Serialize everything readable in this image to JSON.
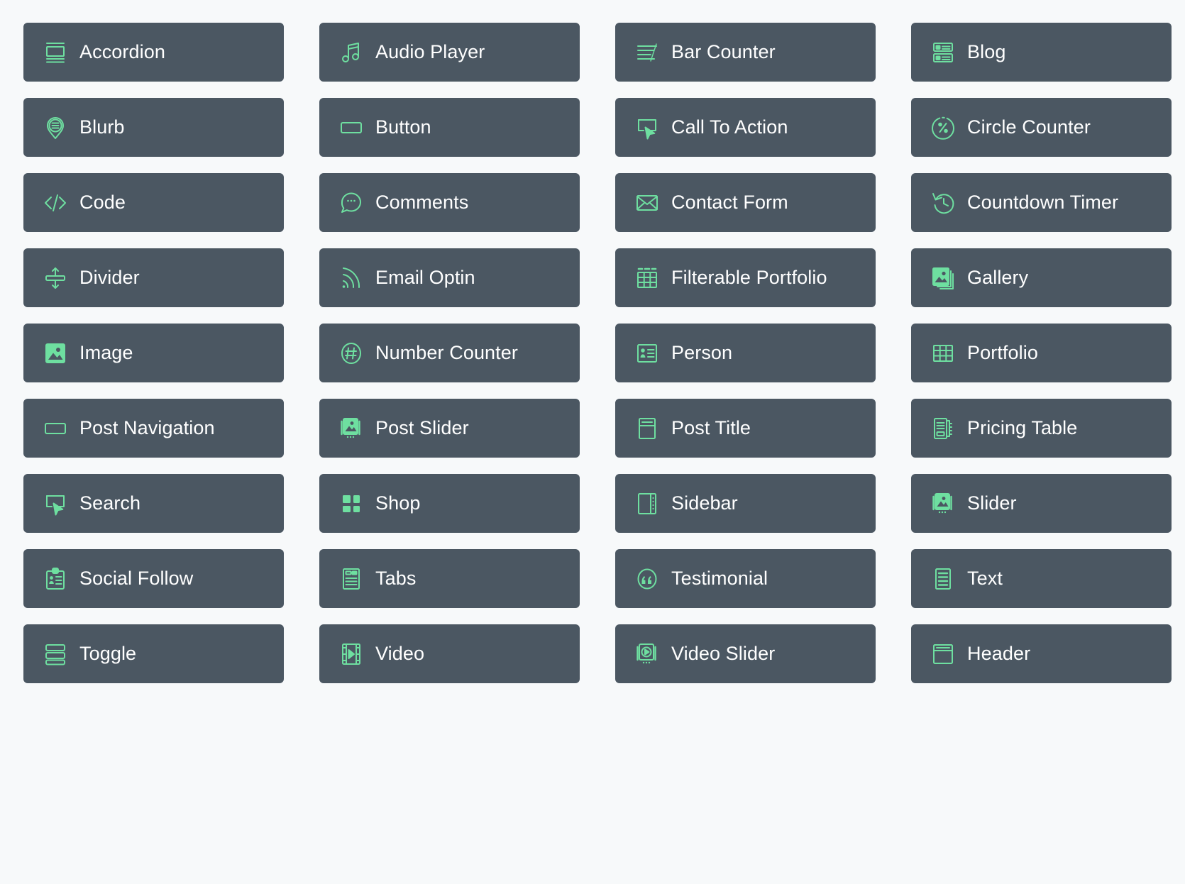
{
  "theme": {
    "page_background": "#f7f9fa",
    "card_background": "#4b5762",
    "icon_color": "#6edfa0",
    "label_color": "#ffffff"
  },
  "grid": {
    "columns": 4,
    "rows": 9,
    "total_modules": 36
  },
  "modules": [
    {
      "label": "Accordion",
      "icon": "accordion-icon"
    },
    {
      "label": "Audio Player",
      "icon": "music-note-icon"
    },
    {
      "label": "Bar Counter",
      "icon": "bar-lines-icon"
    },
    {
      "label": "Blog",
      "icon": "blog-list-icon"
    },
    {
      "label": "Blurb",
      "icon": "blurb-pin-icon"
    },
    {
      "label": "Button",
      "icon": "button-rect-icon"
    },
    {
      "label": "Call To Action",
      "icon": "cursor-click-icon"
    },
    {
      "label": "Circle Counter",
      "icon": "circle-percent-icon"
    },
    {
      "label": "Code",
      "icon": "code-brackets-icon"
    },
    {
      "label": "Comments",
      "icon": "speech-bubble-icon"
    },
    {
      "label": "Contact Form",
      "icon": "envelope-icon"
    },
    {
      "label": "Countdown Timer",
      "icon": "clock-rewind-icon"
    },
    {
      "label": "Divider",
      "icon": "divider-arrows-icon"
    },
    {
      "label": "Email Optin",
      "icon": "rss-signal-icon"
    },
    {
      "label": "Filterable Portfolio",
      "icon": "grid-table-icon"
    },
    {
      "label": "Gallery",
      "icon": "gallery-stack-icon"
    },
    {
      "label": "Image",
      "icon": "image-icon"
    },
    {
      "label": "Number Counter",
      "icon": "hash-circle-icon"
    },
    {
      "label": "Person",
      "icon": "person-card-icon"
    },
    {
      "label": "Portfolio",
      "icon": "grid-cells-icon"
    },
    {
      "label": "Post Navigation",
      "icon": "nav-rect-icon"
    },
    {
      "label": "Post Slider",
      "icon": "image-stack-dots-icon"
    },
    {
      "label": "Post Title",
      "icon": "post-title-icon"
    },
    {
      "label": "Pricing Table",
      "icon": "pricing-table-icon"
    },
    {
      "label": "Search",
      "icon": "cursor-click-icon"
    },
    {
      "label": "Shop",
      "icon": "four-squares-icon"
    },
    {
      "label": "Sidebar",
      "icon": "sidebar-icon"
    },
    {
      "label": "Slider",
      "icon": "image-stack-dots-icon"
    },
    {
      "label": "Social Follow",
      "icon": "social-clipboard-icon"
    },
    {
      "label": "Tabs",
      "icon": "tabs-document-icon"
    },
    {
      "label": "Testimonial",
      "icon": "quote-circle-icon"
    },
    {
      "label": "Text",
      "icon": "text-lines-icon"
    },
    {
      "label": "Toggle",
      "icon": "toggle-stack-icon"
    },
    {
      "label": "Video",
      "icon": "film-play-icon"
    },
    {
      "label": "Video Slider",
      "icon": "video-slider-icon"
    },
    {
      "label": "Header",
      "icon": "header-window-icon"
    }
  ]
}
